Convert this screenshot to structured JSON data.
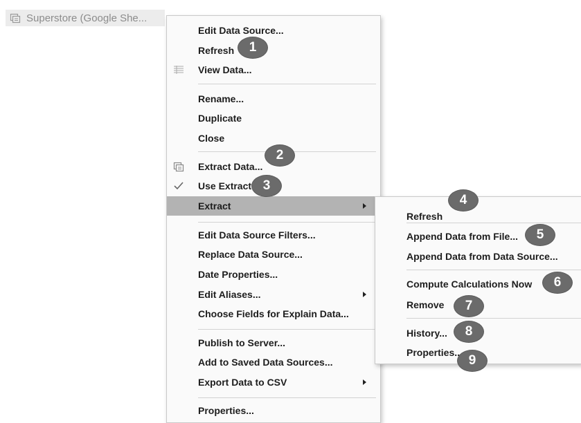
{
  "datasource_tab": {
    "label": "Superstore (Google She...",
    "icon": "datasource-icon"
  },
  "main_menu": {
    "edit_data_source": "Edit Data Source...",
    "refresh": "Refresh",
    "view_data": "View Data...",
    "rename": "Rename...",
    "duplicate": "Duplicate",
    "close": "Close",
    "extract_data": "Extract Data...",
    "use_extract": "Use Extract",
    "extract": "Extract",
    "edit_filters": "Edit Data Source Filters...",
    "replace_data_source": "Replace Data Source...",
    "date_properties": "Date Properties...",
    "edit_aliases": "Edit Aliases...",
    "choose_fields": "Choose Fields for Explain Data...",
    "publish": "Publish to Server...",
    "add_saved": "Add to Saved Data Sources...",
    "export_csv": "Export Data to CSV",
    "properties": "Properties..."
  },
  "extract_submenu": {
    "refresh": "Refresh",
    "append_file": "Append Data from File...",
    "append_source": "Append Data from Data Source...",
    "compute": "Compute Calculations Now",
    "remove": "Remove",
    "history": "History...",
    "properties": "Properties..."
  },
  "badges": [
    "1",
    "2",
    "3",
    "4",
    "5",
    "6",
    "7",
    "8",
    "9"
  ],
  "colors": {
    "highlight": "#b3b3b3",
    "badge": "#6b6b6b",
    "menu_bg": "#fafafa"
  }
}
